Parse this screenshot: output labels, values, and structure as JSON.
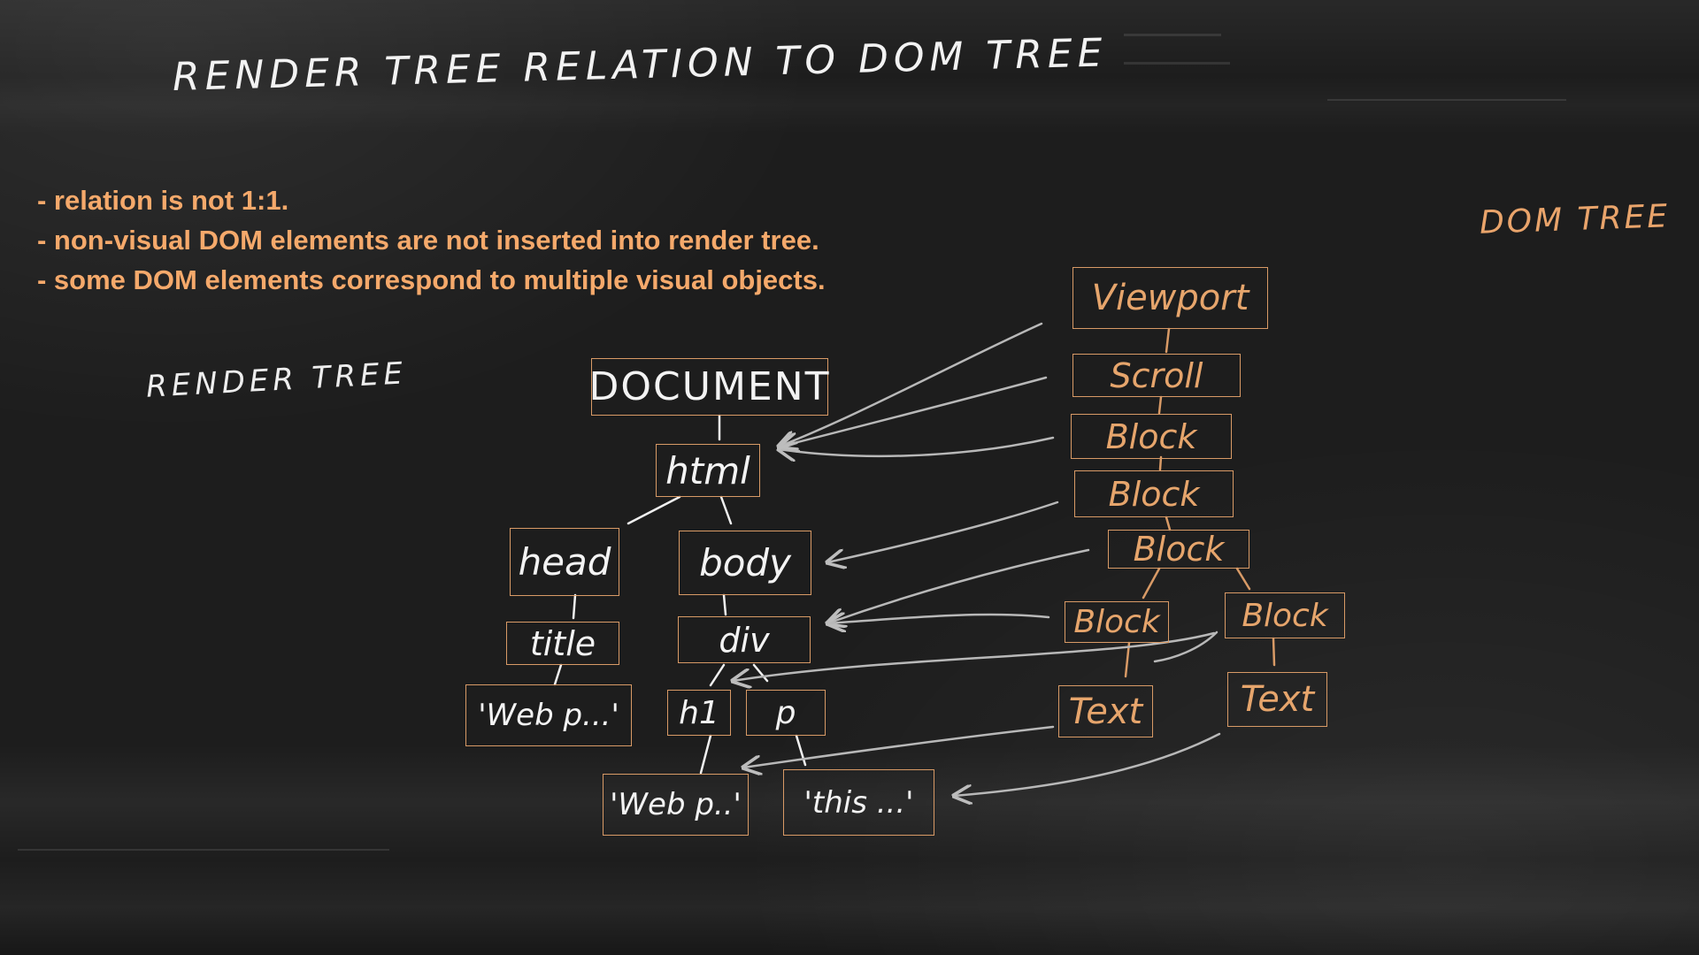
{
  "title": "RENDER TREE RELATION TO DOM TREE",
  "bullets": [
    "- relation is not 1:1.",
    "- non-visual DOM elements are not inserted into render tree.",
    "- some DOM elements correspond to multiple visual objects."
  ],
  "labels": {
    "render_tree": "RENDER TREE",
    "dom_tree": "DOM TREE"
  },
  "dom_nodes": {
    "document": "DOCUMENT",
    "html": "html",
    "head": "head",
    "body": "body",
    "title": "title",
    "div": "div",
    "title_text": "'Web p...'",
    "h1": "h1",
    "p": "p",
    "h1_text": "'Web p..'",
    "p_text": "'this ...'"
  },
  "render_nodes": {
    "viewport": "Viewport",
    "scroll": "Scroll",
    "block1": "Block",
    "block2": "Block",
    "block3": "Block",
    "block4": "Block",
    "block5": "Block",
    "text1": "Text",
    "text2": "Text"
  },
  "colors": {
    "background": "#1c1c1c",
    "accent_orange": "#f5a96b",
    "box_border": "#d89a66",
    "chalk_white": "#f2f2f2",
    "arrow_gray": "#b5b5b5"
  }
}
